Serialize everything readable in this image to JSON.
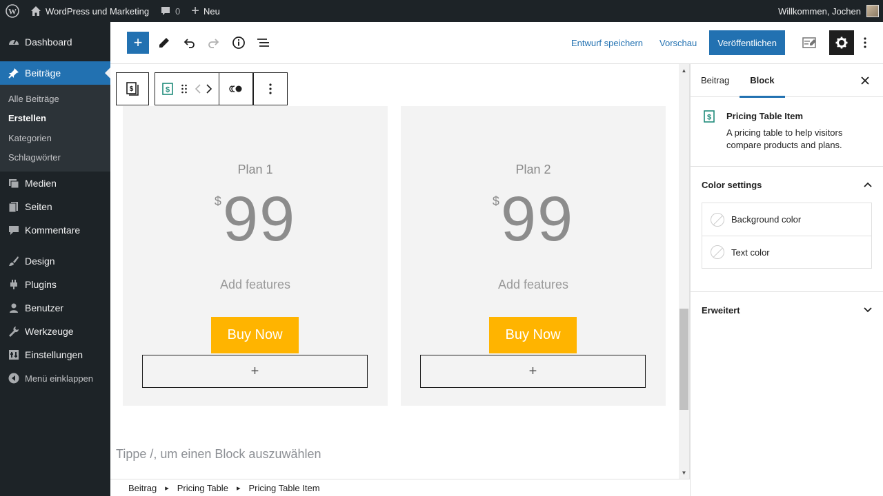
{
  "adminbar": {
    "site_name": "WordPress und Marketing",
    "comments_count": "0",
    "new_label": "Neu",
    "greeting": "Willkommen, Jochen"
  },
  "sidebar": {
    "items": [
      {
        "label": "Dashboard",
        "icon": "dashboard-icon"
      },
      {
        "label": "Beiträge",
        "icon": "pin-icon"
      },
      {
        "label": "Medien",
        "icon": "media-icon"
      },
      {
        "label": "Seiten",
        "icon": "pages-icon"
      },
      {
        "label": "Kommentare",
        "icon": "comments-icon"
      },
      {
        "label": "Design",
        "icon": "brush-icon"
      },
      {
        "label": "Plugins",
        "icon": "plugin-icon"
      },
      {
        "label": "Benutzer",
        "icon": "user-icon"
      },
      {
        "label": "Werkzeuge",
        "icon": "wrench-icon"
      },
      {
        "label": "Einstellungen",
        "icon": "settings-icon"
      },
      {
        "label": "Menü einklappen",
        "icon": "collapse-icon"
      }
    ],
    "submenu": [
      "Alle Beiträge",
      "Erstellen",
      "Kategorien",
      "Schlagwörter"
    ]
  },
  "header": {
    "save_draft": "Entwurf speichern",
    "preview": "Vorschau",
    "publish": "Veröffentlichen"
  },
  "plans": [
    {
      "title": "Plan 1",
      "currency": "$",
      "price": "99",
      "features": "Add features",
      "button": "Buy Now"
    },
    {
      "title": "Plan 2",
      "currency": "$",
      "price": "99",
      "features": "Add features",
      "button": "Buy Now"
    }
  ],
  "placeholder": "Tippe /, um einen Block auszuwählen",
  "breadcrumb": [
    "Beitrag",
    "Pricing Table",
    "Pricing Table Item"
  ],
  "panel": {
    "tabs": [
      "Beitrag",
      "Block"
    ],
    "block_title": "Pricing Table Item",
    "block_desc": "A pricing table to help visitors compare products and plans.",
    "color_settings": "Color settings",
    "background_color": "Background color",
    "text_color": "Text color",
    "advanced": "Erweitert"
  },
  "colors": {
    "accent": "#2271b1",
    "button": "#ffb400",
    "admin": "#1d2327"
  }
}
